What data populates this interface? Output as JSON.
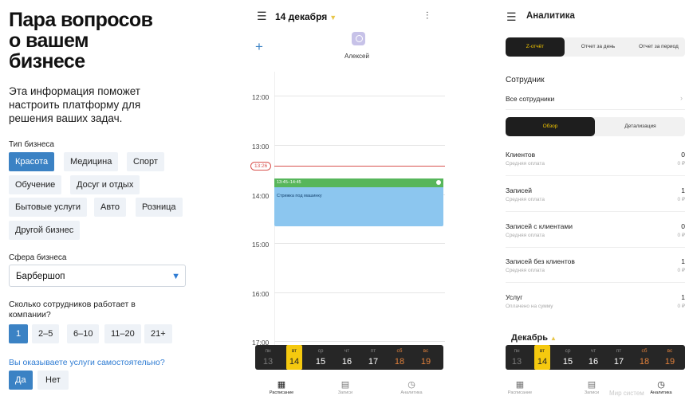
{
  "onboarding": {
    "title_lines": [
      "Пара вопросов",
      "о вашем",
      "бизнесе"
    ],
    "lead_lines": [
      "Эта информация поможет",
      "настроить платформу для",
      "решения ваших задач."
    ],
    "business_type_label": "Тип бизнеса",
    "business_types": [
      "Красота",
      "Медицина",
      "Спорт",
      "Обучение",
      "Досуг и отдых",
      "Бытовые услуги",
      "Авто",
      "Розница",
      "Другой бизнес"
    ],
    "selected_business_type": "Красота",
    "sphere_label": "Сфера бизнеса",
    "sphere_value": "Барбершоп",
    "employees_question_lines": [
      "Сколько сотрудников работает в",
      "компании?"
    ],
    "employee_options": [
      "1",
      "2–5",
      "6–10",
      "11–20",
      "21+"
    ],
    "selected_employee_option": "1",
    "self_service_question": "Вы оказываете услуги самостоятельно?",
    "yes_no": [
      "Да",
      "Нет"
    ],
    "selected_yes_no": "Да"
  },
  "schedule": {
    "date": "14 декабря",
    "staff_name": "Алексей",
    "hours": [
      "12:00",
      "13:00",
      "14:00",
      "15:00",
      "16:00",
      "17:00"
    ],
    "now_time": "13:26",
    "event": {
      "time": "13:45–14:45",
      "title": "Стрижка под машинку",
      "color": "#8cc6ef",
      "header_color": "#57b65b"
    },
    "week": [
      {
        "wd": "пн",
        "d": "13"
      },
      {
        "wd": "вт",
        "d": "14"
      },
      {
        "wd": "ср",
        "d": "15"
      },
      {
        "wd": "чт",
        "d": "16"
      },
      {
        "wd": "пт",
        "d": "17"
      },
      {
        "wd": "сб",
        "d": "18"
      },
      {
        "wd": "вс",
        "d": "19"
      }
    ],
    "selected_day": "14",
    "tabs": [
      "Расписание",
      "Записи",
      "Аналитика"
    ],
    "active_tab": "Расписание"
  },
  "analytics": {
    "title": "Аналитика",
    "report_tabs": [
      "Z-отчёт",
      "Отчет за день",
      "Отчет за период"
    ],
    "active_report_tab": "Z-отчёт",
    "staff_label": "Сотрудник",
    "staff_value": "Все сотрудники",
    "view_tabs": [
      "Обзор",
      "Детализация"
    ],
    "active_view_tab": "Обзор",
    "stats": [
      {
        "title": "Клиентов",
        "sub": "Средняя оплата",
        "value": "0",
        "sub_value": "0 ₽"
      },
      {
        "title": "Записей",
        "sub": "Средняя оплата",
        "value": "1",
        "sub_value": "0 ₽"
      },
      {
        "title": "Записей с клиентами",
        "sub": "Средняя оплата",
        "value": "0",
        "sub_value": "0 ₽"
      },
      {
        "title": "Записей без клиентов",
        "sub": "Средняя оплата",
        "value": "1",
        "sub_value": "0 ₽"
      },
      {
        "title": "Услуг",
        "sub": "Оплачено на сумму",
        "value": "1",
        "sub_value": "0 ₽"
      }
    ],
    "month": "Декабрь",
    "tabs": [
      "Расписание",
      "Записи",
      "Аналитика"
    ],
    "active_tab": "Аналитика",
    "watermark": "Мир систем"
  },
  "colors": {
    "accent_blue": "#3b82c4",
    "chip_bg": "#eef2f7",
    "now_red": "#d9534f",
    "yellow": "#f5c90f",
    "dark": "#262626"
  }
}
